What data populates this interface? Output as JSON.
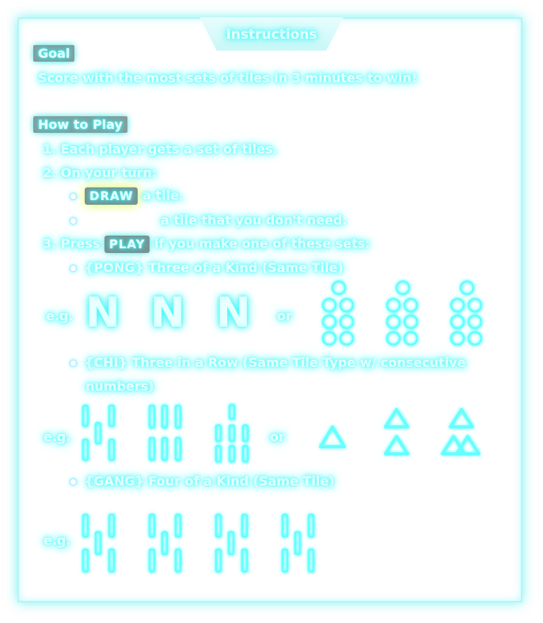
{
  "title": "Instructions",
  "goal": {
    "heading": "Goal",
    "text": "Score with the most sets of tiles in 3 minutes to win!"
  },
  "how_to_play": {
    "heading": "How to Play",
    "step1": "1. Each player gets a set of tiles.",
    "step2": "2. On your turn:",
    "draw_button": "DRAW",
    "draw_suffix": "a tile.",
    "discard_suffix": "a tile that you don't need.",
    "step3_prefix": "3. Press",
    "play_button": "PLAY",
    "step3_suffix": "if you make one of these sets:"
  },
  "sets": {
    "pong": "{PONG} Three of a Kind (Same Tile)",
    "chi": "{CHI} Three in a Row (Same Tile Type w/ consecutive",
    "chi_cont": "numbers)",
    "gang": "{GANG} Four of a Kind (Same Tile)"
  },
  "example_label": "e.g.",
  "or_label": "or",
  "pong_letter": "N",
  "colors": {
    "neon": "#33ffff",
    "tag_bg": "#8a9a9a",
    "draw_glow": "#ffff99"
  },
  "icons": [
    "pong-tile-N-icon",
    "circle-tile-icon",
    "bamboo-tile-icon",
    "triangle-tile-icon"
  ]
}
